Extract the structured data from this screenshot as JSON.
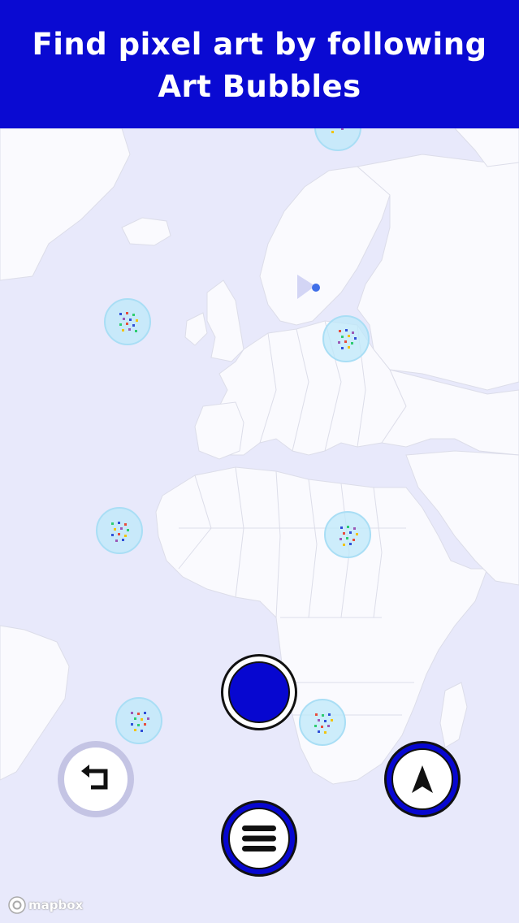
{
  "banner": {
    "line1": "Find pixel art by following",
    "line2": "Art Bubbles"
  },
  "map": {
    "attribution": "mapbox",
    "land_color": "#fafafe",
    "water_color": "#e8e9fb",
    "border_color": "#d8d9e8"
  },
  "bubbles": [
    {
      "id": "north-sea-top"
    },
    {
      "id": "atlantic-north"
    },
    {
      "id": "eastern-europe"
    },
    {
      "id": "west-africa-coast"
    },
    {
      "id": "sahara-east"
    },
    {
      "id": "south-atlantic"
    },
    {
      "id": "southern-africa"
    }
  ],
  "controls": {
    "record": {
      "icon": "record-circle-icon",
      "color": "#0707d0"
    },
    "back": {
      "icon": "return-arrow-icon"
    },
    "compass": {
      "icon": "navigation-arrow-icon"
    },
    "menu": {
      "icon": "hamburger-menu-icon"
    }
  },
  "accent": "#0a0ad2"
}
